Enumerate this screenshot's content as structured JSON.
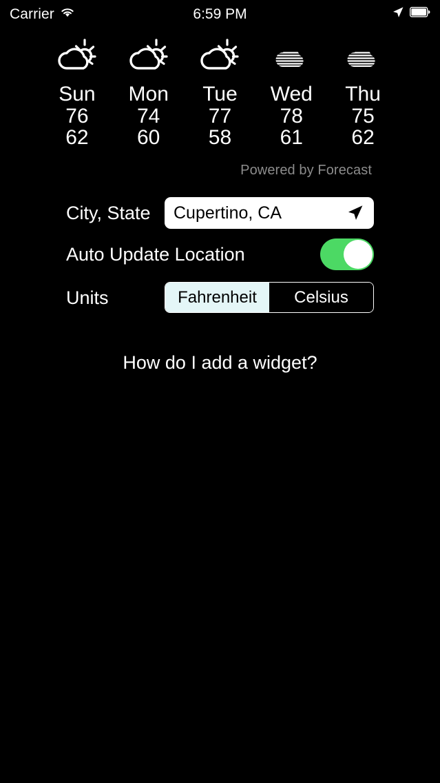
{
  "status_bar": {
    "carrier": "Carrier",
    "wifi_icon": "wifi-icon",
    "time": "6:59 PM",
    "location_icon": "location-arrow-icon",
    "battery_icon": "battery-full-icon"
  },
  "forecast": {
    "days": [
      {
        "name": "Sun",
        "icon": "partly-cloudy-icon",
        "high": "76",
        "low": "62"
      },
      {
        "name": "Mon",
        "icon": "partly-cloudy-icon",
        "high": "74",
        "low": "60"
      },
      {
        "name": "Tue",
        "icon": "partly-cloudy-icon",
        "high": "77",
        "low": "58"
      },
      {
        "name": "Wed",
        "icon": "striped-cloud-icon",
        "high": "78",
        "low": "61"
      },
      {
        "name": "Thu",
        "icon": "striped-cloud-icon",
        "high": "75",
        "low": "62"
      }
    ],
    "attribution": "Powered by Forecast"
  },
  "settings": {
    "city": {
      "label": "City, State",
      "value": "Cupertino, CA",
      "placeholder": "City, State",
      "locate_icon": "location-arrow-icon"
    },
    "auto_update": {
      "label": "Auto Update Location",
      "state": "on"
    },
    "units": {
      "label": "Units",
      "options": [
        "Fahrenheit",
        "Celsius"
      ],
      "selected": "Fahrenheit"
    }
  },
  "help": {
    "link_text": "How do I add a widget?"
  },
  "colors": {
    "background": "#000000",
    "toggle_on": "#4cd964",
    "segment_selected_bg": "#e4f6f7",
    "attribution_text": "#8c8c8c",
    "field_bg": "#ffffff"
  }
}
